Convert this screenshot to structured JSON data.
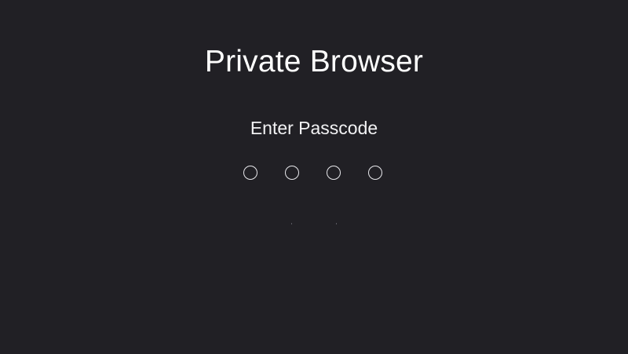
{
  "app": {
    "title": "Private Browser"
  },
  "passcode": {
    "prompt": "Enter Passcode",
    "length": 4,
    "entered": 0
  },
  "colors": {
    "background": "#212025",
    "text": "#ffffff",
    "dot_outline": "#e8e8ec"
  }
}
